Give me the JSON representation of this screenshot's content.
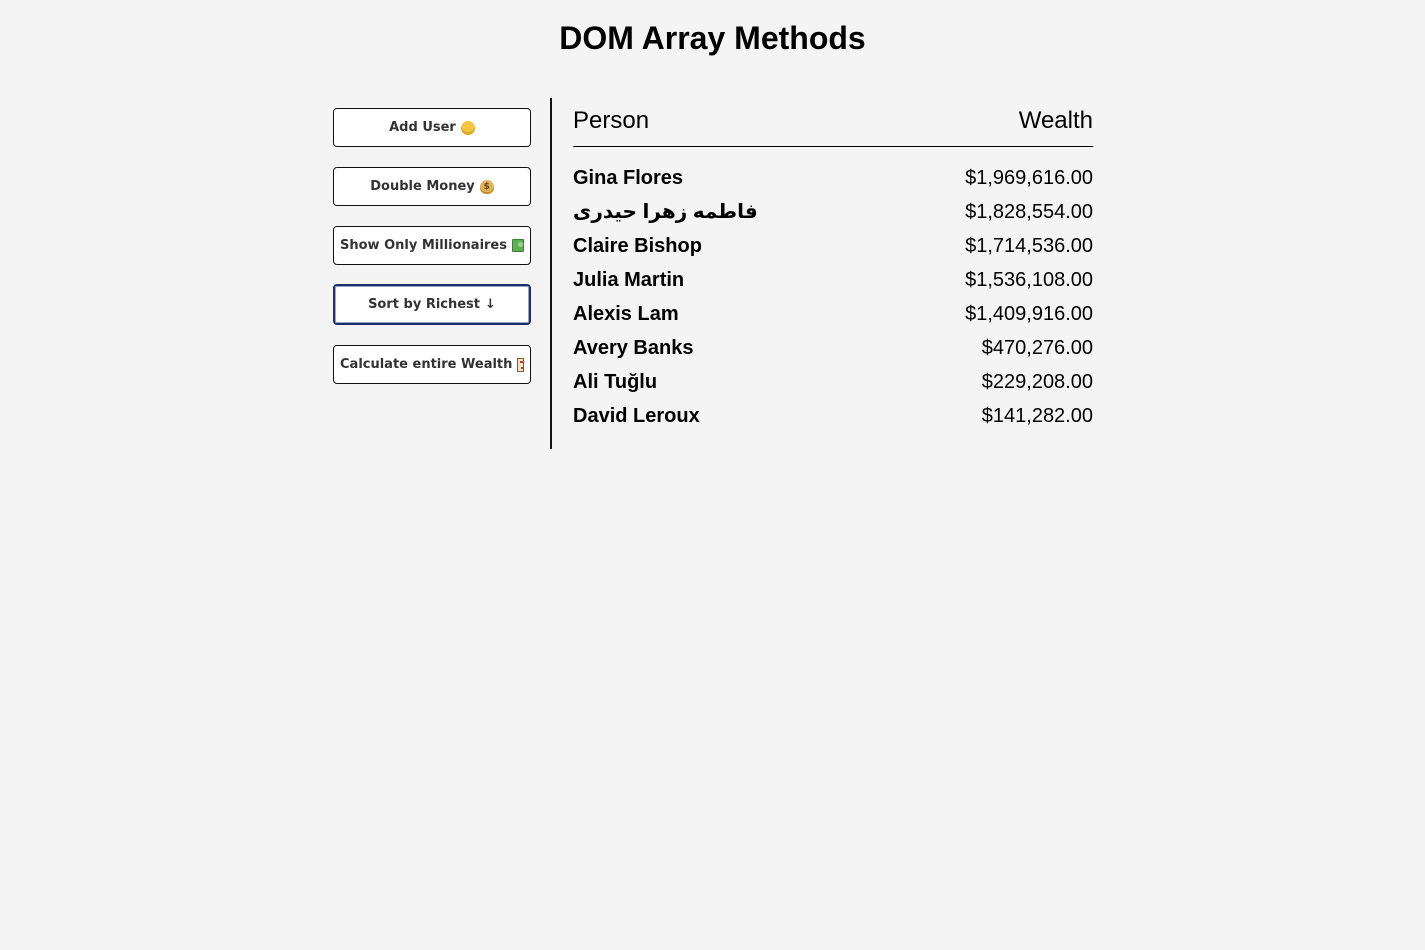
{
  "page": {
    "title": "DOM Array Methods"
  },
  "actions": {
    "add_user": {
      "label": "Add User",
      "icon": "man-emoji-icon"
    },
    "double_money": {
      "label": "Double Money",
      "icon": "money-bag-icon"
    },
    "show_millionaires": {
      "label": "Show Only Millionaires",
      "icon": "dollar-bill-icon"
    },
    "sort_richest": {
      "label": "Sort by Richest",
      "icon": "↓"
    },
    "calculate_wealth": {
      "label": "Calculate entire Wealth",
      "icon": "abacus-icon"
    }
  },
  "table": {
    "header_person": "Person",
    "header_wealth": "Wealth",
    "rows": [
      {
        "name": "Gina Flores",
        "wealth": "$1,969,616.00"
      },
      {
        "name": "فاطمه زهرا حیدری",
        "wealth": "$1,828,554.00"
      },
      {
        "name": "Claire Bishop",
        "wealth": "$1,714,536.00"
      },
      {
        "name": "Julia Martin",
        "wealth": "$1,536,108.00"
      },
      {
        "name": "Alexis Lam",
        "wealth": "$1,409,916.00"
      },
      {
        "name": "Avery Banks",
        "wealth": "$470,276.00"
      },
      {
        "name": "Ali Tuğlu",
        "wealth": "$229,208.00"
      },
      {
        "name": "David Leroux",
        "wealth": "$141,282.00"
      }
    ]
  },
  "colors": {
    "background": "#f4f4f4",
    "button_background": "#ffffff",
    "focus_border": "#1a2f6b"
  }
}
